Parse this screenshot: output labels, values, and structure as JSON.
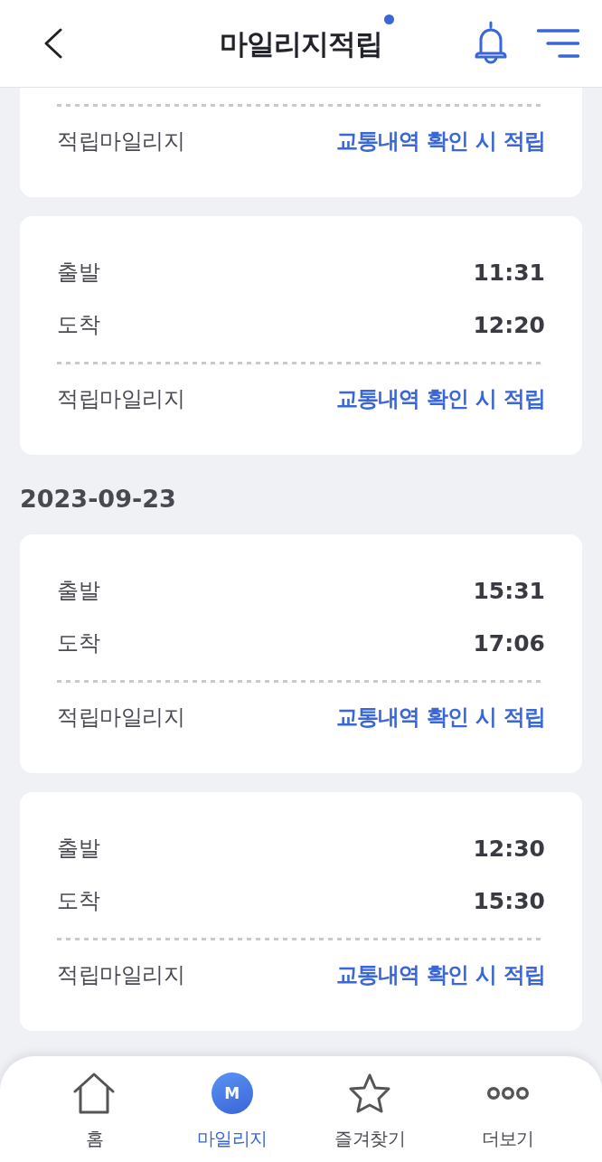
{
  "header": {
    "title": "마일리지적립",
    "notification_dot": true
  },
  "groups": [
    {
      "cards": [
        {
          "mileage_label": "적립마일리지",
          "mileage_value": "교통내역 확인 시 적립"
        },
        {
          "times": [
            {
              "label": "출발",
              "value": "11:31"
            },
            {
              "label": "도착",
              "value": "12:20"
            }
          ],
          "mileage_label": "적립마일리지",
          "mileage_value": "교통내역 확인 시 적립"
        }
      ]
    },
    {
      "date": "2023-09-23",
      "cards": [
        {
          "times": [
            {
              "label": "출발",
              "value": "15:31"
            },
            {
              "label": "도착",
              "value": "17:06"
            }
          ],
          "mileage_label": "적립마일리지",
          "mileage_value": "교통내역 확인 시 적립"
        },
        {
          "times": [
            {
              "label": "출발",
              "value": "12:30"
            },
            {
              "label": "도착",
              "value": "15:30"
            }
          ],
          "mileage_label": "적립마일리지",
          "mileage_value": "교통내역 확인 시 적립"
        }
      ]
    }
  ],
  "bottom_nav": [
    {
      "kind": "home",
      "label": "홈",
      "selected": false
    },
    {
      "kind": "mileage",
      "icon_text": "M",
      "label": "마일리지",
      "selected": true
    },
    {
      "kind": "star",
      "label": "즐겨찾기",
      "selected": false
    },
    {
      "kind": "more",
      "label": "더보기",
      "selected": false
    }
  ]
}
